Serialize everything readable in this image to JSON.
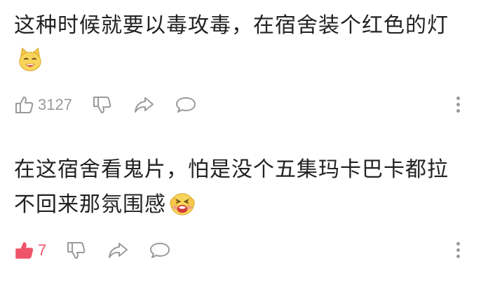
{
  "comments": [
    {
      "text": "这种时候就要以毒攻毒，在宿舍装个红色的灯",
      "emoji": "grinning-cat-emoji",
      "likes": "3127",
      "liked": false
    },
    {
      "text": "在这宿舍看鬼片，怕是没个五集玛卡巴卡都拉不回来那氛围感",
      "emoji": "squeezing-face-emoji",
      "likes": "7",
      "liked": true
    }
  ],
  "colors": {
    "icon_gray": "#9a9a9a",
    "liked_pink": "#f0546a",
    "text": "#222222"
  },
  "icons": {
    "like": "thumbs-up-icon",
    "dislike": "thumbs-down-icon",
    "share": "share-arrow-icon",
    "reply": "speech-bubble-icon",
    "more": "vertical-dots-icon"
  }
}
